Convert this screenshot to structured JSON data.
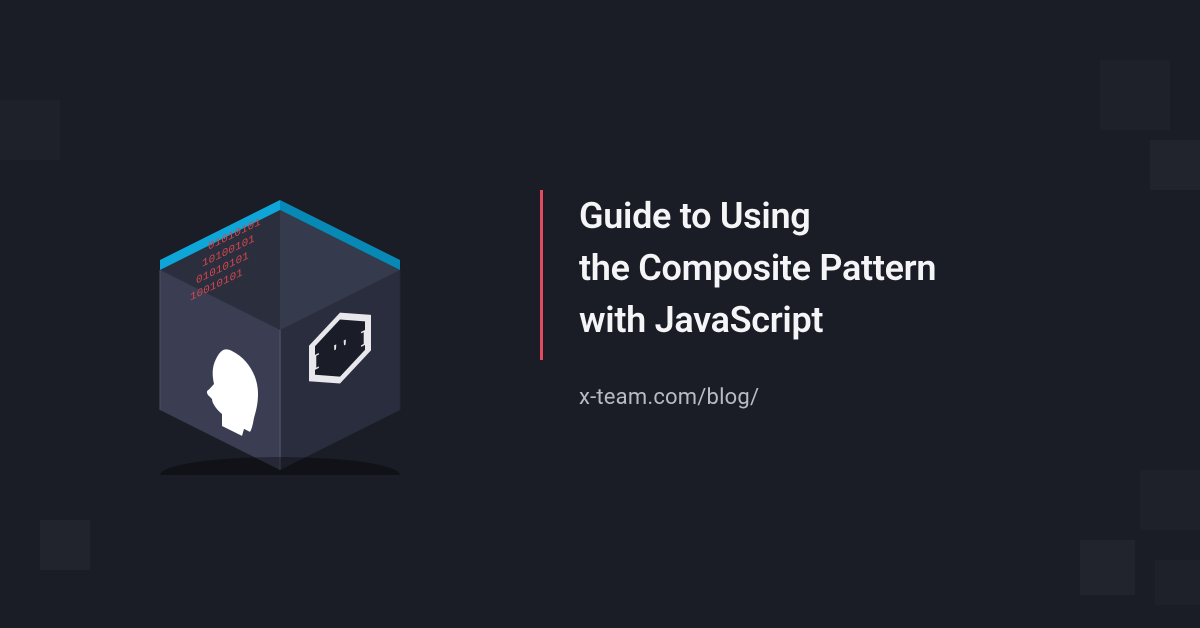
{
  "title_line1": "Guide to Using",
  "title_line2": "the Composite Pattern",
  "title_line3": "with JavaScript",
  "url": "x-team.com/blog/",
  "cube": {
    "binary_rows": [
      "01010101",
      "10100101",
      "01010101",
      "10010101"
    ],
    "bracket_text": "[ '' ]"
  },
  "colors": {
    "accent": "#e24b5e",
    "bg": "#1a1d26",
    "cyan": "#0ea5d9"
  }
}
